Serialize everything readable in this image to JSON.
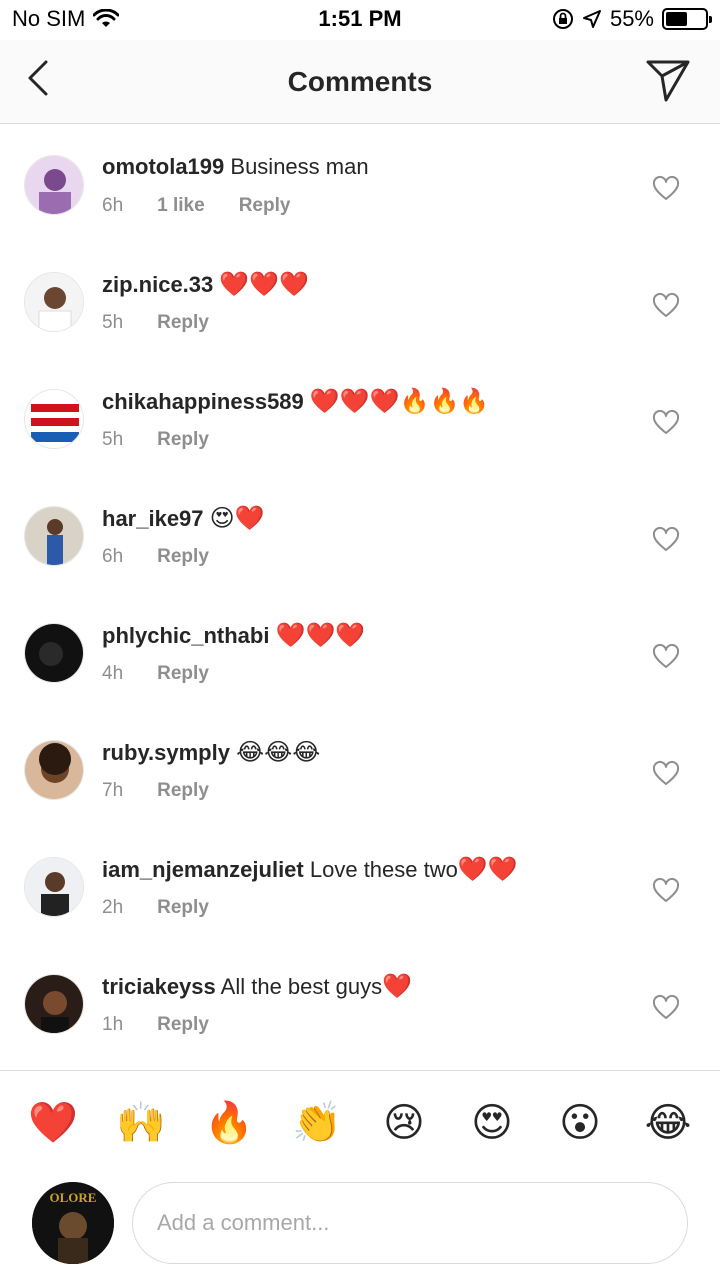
{
  "status_bar": {
    "carrier": "No SIM",
    "time": "1:51 PM",
    "battery_percent": "55%",
    "battery_level": 0.55
  },
  "nav": {
    "title": "Comments",
    "back_icon": "chevron-left-icon",
    "send_icon": "paper-plane-icon"
  },
  "comments": [
    {
      "username": "omotola199",
      "text": "Business man",
      "emoji": "",
      "time": "6h",
      "likes": "1 like",
      "reply": "Reply"
    },
    {
      "username": "zip.nice.33",
      "text": "",
      "emoji": "❤️❤️❤️",
      "time": "5h",
      "likes": "",
      "reply": "Reply"
    },
    {
      "username": "chikahappiness589",
      "text": "",
      "emoji": "❤️❤️❤️🔥🔥🔥",
      "time": "5h",
      "likes": "",
      "reply": "Reply"
    },
    {
      "username": "har_ike97",
      "text": "",
      "emoji": "😍❤️",
      "time": "6h",
      "likes": "",
      "reply": "Reply"
    },
    {
      "username": "phlychic_nthabi",
      "text": "",
      "emoji": "❤️❤️❤️",
      "time": "4h",
      "likes": "",
      "reply": "Reply"
    },
    {
      "username": "ruby.symply",
      "text": "",
      "emoji": "😂😂😂",
      "time": "7h",
      "likes": "",
      "reply": "Reply"
    },
    {
      "username": "iam_njemanzejuliet",
      "text": "Love these two",
      "emoji": "❤️❤️",
      "time": "2h",
      "likes": "",
      "reply": "Reply"
    },
    {
      "username": "triciakeyss",
      "text": "All the best guys",
      "emoji": "❤️",
      "time": "1h",
      "likes": "",
      "reply": "Reply"
    }
  ],
  "quick_emojis": [
    "❤️",
    "🙌",
    "🔥",
    "👏",
    "😢",
    "😍",
    "😮",
    "😂"
  ],
  "composer": {
    "placeholder": "Add a comment...",
    "avatar_text": "OLORE"
  },
  "colors": {
    "text_primary": "#262626",
    "text_secondary": "#8e8e8e",
    "divider": "#dbdbdb"
  }
}
